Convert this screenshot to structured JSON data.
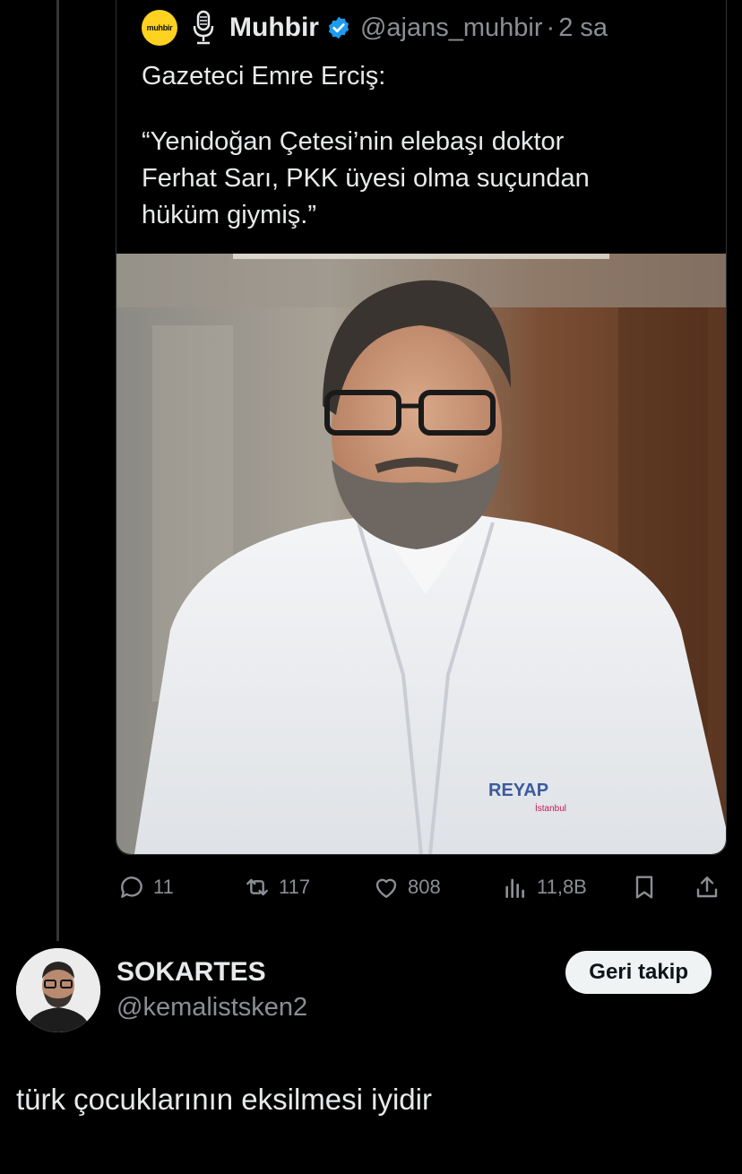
{
  "quoted_tweet": {
    "avatar_text": "muhbir",
    "name": "Muhbir",
    "handle": "@ajans_muhbir",
    "separator": "·",
    "time": "2 sa",
    "text_line1": "Gazeteci Emre Erciş:",
    "text_line2": "“Yenidoğan Çetesi’nin elebaşı doktor",
    "text_line3": "Ferhat Sarı, PKK üyesi olma suçundan",
    "text_line4": "hüküm giymiş.”",
    "photo_logo": "REYAP",
    "photo_logo_sub": "İstanbul"
  },
  "actions": {
    "replies": "11",
    "reposts": "117",
    "likes": "808",
    "views": "11,8B"
  },
  "icons": {
    "reply": "reply-icon",
    "repost": "repost-icon",
    "like": "like-icon",
    "views": "views-icon",
    "bookmark": "bookmark-icon",
    "share": "share-icon",
    "verified": "verified-badge-icon"
  },
  "reply_user": {
    "name": "SOKARTES",
    "handle": "@kemalistsken2",
    "follow_label": "Geri takip"
  },
  "reply_text": "türk çocuklarının eksilmesi iyidir",
  "colors": {
    "background": "#000000",
    "text": "#e7e9ea",
    "secondary": "#8b8f94",
    "verified": "#1d9bf0",
    "muhbir_yellow": "#ffd21f"
  }
}
